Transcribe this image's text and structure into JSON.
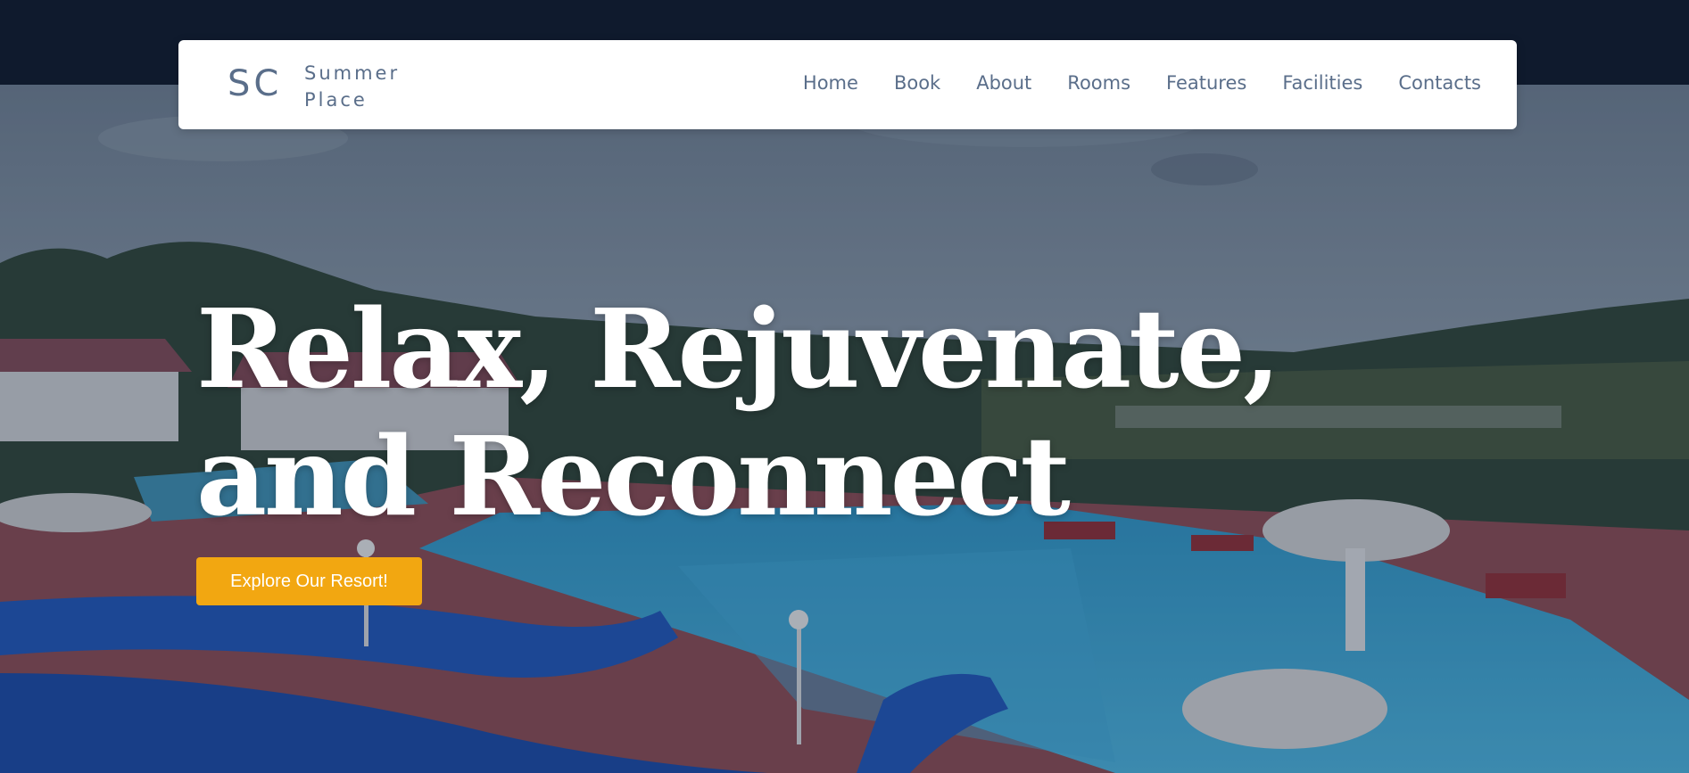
{
  "logo": {
    "mark": "SC",
    "name_line1": "Summer",
    "name_line2": "Place"
  },
  "nav": {
    "items": [
      {
        "label": "Home"
      },
      {
        "label": "Book"
      },
      {
        "label": "About"
      },
      {
        "label": "Rooms"
      },
      {
        "label": "Features"
      },
      {
        "label": "Facilities"
      },
      {
        "label": "Contacts"
      }
    ]
  },
  "hero": {
    "headline_line1": "Relax, Rejuvenate,",
    "headline_line2": "and Reconnect",
    "cta_label": "Explore Our Resort!"
  },
  "colors": {
    "topbar": "#0f1a2d",
    "accent": "#f2a711",
    "nav_text": "#5a6e8a",
    "navbar_bg": "#ffffff"
  }
}
